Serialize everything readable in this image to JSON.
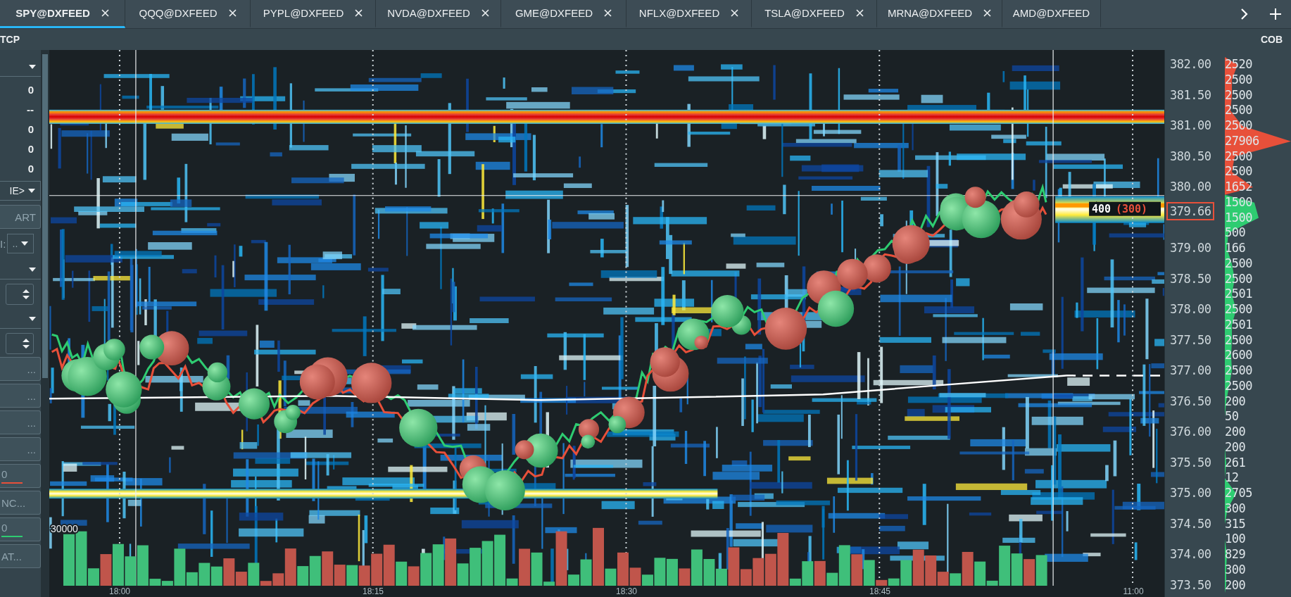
{
  "tabs": [
    {
      "label": "SPY@DXFEED",
      "selected": true
    },
    {
      "label": "QQQ@DXFEED",
      "selected": false
    },
    {
      "label": "PYPL@DXFEED",
      "selected": false
    },
    {
      "label": "NVDA@DXFEED",
      "selected": false
    },
    {
      "label": "GME@DXFEED",
      "selected": false
    },
    {
      "label": "NFLX@DXFEED",
      "selected": false
    },
    {
      "label": "TSLA@DXFEED",
      "selected": false
    },
    {
      "label": "MRNA@DXFEED",
      "selected": false
    },
    {
      "label": "AMD@DXFEED",
      "selected": false
    }
  ],
  "left_header": "TCP",
  "cob_header": "COB",
  "left_panel": {
    "items": [
      {
        "kind": "dropdown"
      },
      {
        "kind": "value",
        "text": "0"
      },
      {
        "kind": "value",
        "text": "--"
      },
      {
        "kind": "value",
        "text": "0"
      },
      {
        "kind": "value",
        "text": "0"
      },
      {
        "kind": "value",
        "text": "0"
      },
      {
        "kind": "dropdown",
        "value": "IE>"
      },
      {
        "kind": "button",
        "label": "ART"
      },
      {
        "kind": "labeled_dropdown",
        "label": "I:",
        "value": ".."
      },
      {
        "kind": "dropdown"
      },
      {
        "kind": "spinner"
      },
      {
        "kind": "dropdown"
      },
      {
        "kind": "spinner"
      },
      {
        "kind": "button",
        "label": "..."
      },
      {
        "kind": "button",
        "label": "..."
      },
      {
        "kind": "button",
        "label": "..."
      },
      {
        "kind": "button",
        "label": "..."
      },
      {
        "kind": "line_button",
        "label": "0",
        "color": "#e8503a"
      },
      {
        "kind": "button",
        "label": "NC..."
      },
      {
        "kind": "line_button",
        "label": "0",
        "color": "#2ecc71"
      },
      {
        "kind": "button",
        "label": "AT..."
      }
    ]
  },
  "chart": {
    "volume_scale_label": "30000",
    "order_size": "400",
    "order_hidden_size": "(300)",
    "time_labels": [
      "18:00",
      "18:15",
      "18:30",
      "18:45",
      "11:00"
    ]
  },
  "price_axis": {
    "labels": [
      {
        "text": "382.00"
      },
      {
        "text": "381.50"
      },
      {
        "text": "381.00"
      },
      {
        "text": "380.50"
      },
      {
        "text": "380.00"
      },
      {
        "text": "379.66",
        "kind": "current"
      },
      {
        "text": "379.00"
      },
      {
        "text": "378.50"
      },
      {
        "text": "378.00"
      },
      {
        "text": "377.50"
      },
      {
        "text": "377.00"
      },
      {
        "text": "376.50"
      },
      {
        "text": "376.00"
      },
      {
        "text": "375.50"
      },
      {
        "text": "375.00"
      },
      {
        "text": "374.50"
      },
      {
        "text": "374.00"
      },
      {
        "text": "373.50"
      }
    ]
  },
  "cob": [
    {
      "size": "2520"
    },
    {
      "size": "2500"
    },
    {
      "size": "2500"
    },
    {
      "size": "2500"
    },
    {
      "size": "2500"
    },
    {
      "size": "27906"
    },
    {
      "size": "2500"
    },
    {
      "size": "2500"
    },
    {
      "size": "1652"
    },
    {
      "size": "1500"
    },
    {
      "size": "1500"
    },
    {
      "size": "500"
    },
    {
      "size": "166"
    },
    {
      "size": "2500"
    },
    {
      "size": "2500"
    },
    {
      "size": "2501"
    },
    {
      "size": "2500"
    },
    {
      "size": "2501"
    },
    {
      "size": "2500"
    },
    {
      "size": "2600"
    },
    {
      "size": "2500"
    },
    {
      "size": "2500"
    },
    {
      "size": "200"
    },
    {
      "size": "50"
    },
    {
      "size": "200"
    },
    {
      "size": "200"
    },
    {
      "size": "261"
    },
    {
      "size": "12"
    },
    {
      "size": "2705"
    },
    {
      "size": "300"
    },
    {
      "size": "315"
    },
    {
      "size": "100"
    },
    {
      "size": "829"
    },
    {
      "size": "300"
    },
    {
      "size": "200"
    }
  ]
}
